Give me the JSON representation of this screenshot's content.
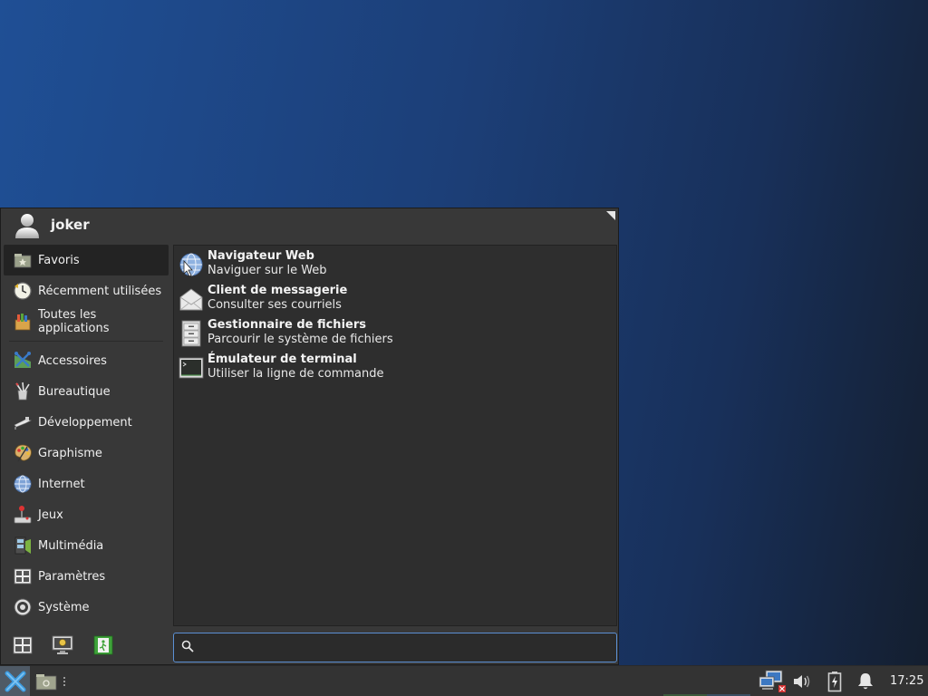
{
  "menu": {
    "user": {
      "name": "joker"
    },
    "categories": [
      {
        "label": "Favoris",
        "icon": "favorites-icon",
        "active": true
      },
      {
        "label": "Récemment utilisées",
        "icon": "recent-clock-icon"
      },
      {
        "label": "Toutes les applications",
        "icon": "all-apps-icon"
      },
      {
        "label": "Accessoires",
        "icon": "accessories-icon"
      },
      {
        "label": "Bureautique",
        "icon": "office-icon"
      },
      {
        "label": "Développement",
        "icon": "development-icon"
      },
      {
        "label": "Graphisme",
        "icon": "graphics-palette-icon"
      },
      {
        "label": "Internet",
        "icon": "internet-globe-icon"
      },
      {
        "label": "Jeux",
        "icon": "games-joystick-icon"
      },
      {
        "label": "Multimédia",
        "icon": "multimedia-film-icon"
      },
      {
        "label": "Paramètres",
        "icon": "settings-panel-icon"
      },
      {
        "label": "Système",
        "icon": "system-gear-icon"
      }
    ],
    "favorites": [
      {
        "title": "Navigateur Web",
        "subtitle": "Naviguer sur le Web",
        "icon": "web-browser-icon"
      },
      {
        "title": "Client de messagerie",
        "subtitle": "Consulter ses courriels",
        "icon": "mail-client-icon"
      },
      {
        "title": "Gestionnaire de fichiers",
        "subtitle": "Parcourir le système de fichiers",
        "icon": "file-manager-icon"
      },
      {
        "title": "Émulateur de terminal",
        "subtitle": "Utiliser la ligne de commande",
        "icon": "terminal-icon"
      }
    ],
    "search": {
      "value": "",
      "placeholder": ""
    }
  },
  "taskbar": {
    "clock": "17:25"
  },
  "colors": {
    "accent": "#5b8fd3",
    "menu_bg": "#383838",
    "panel_bg": "#2e2e2e",
    "taskbar_bg": "#333333"
  }
}
